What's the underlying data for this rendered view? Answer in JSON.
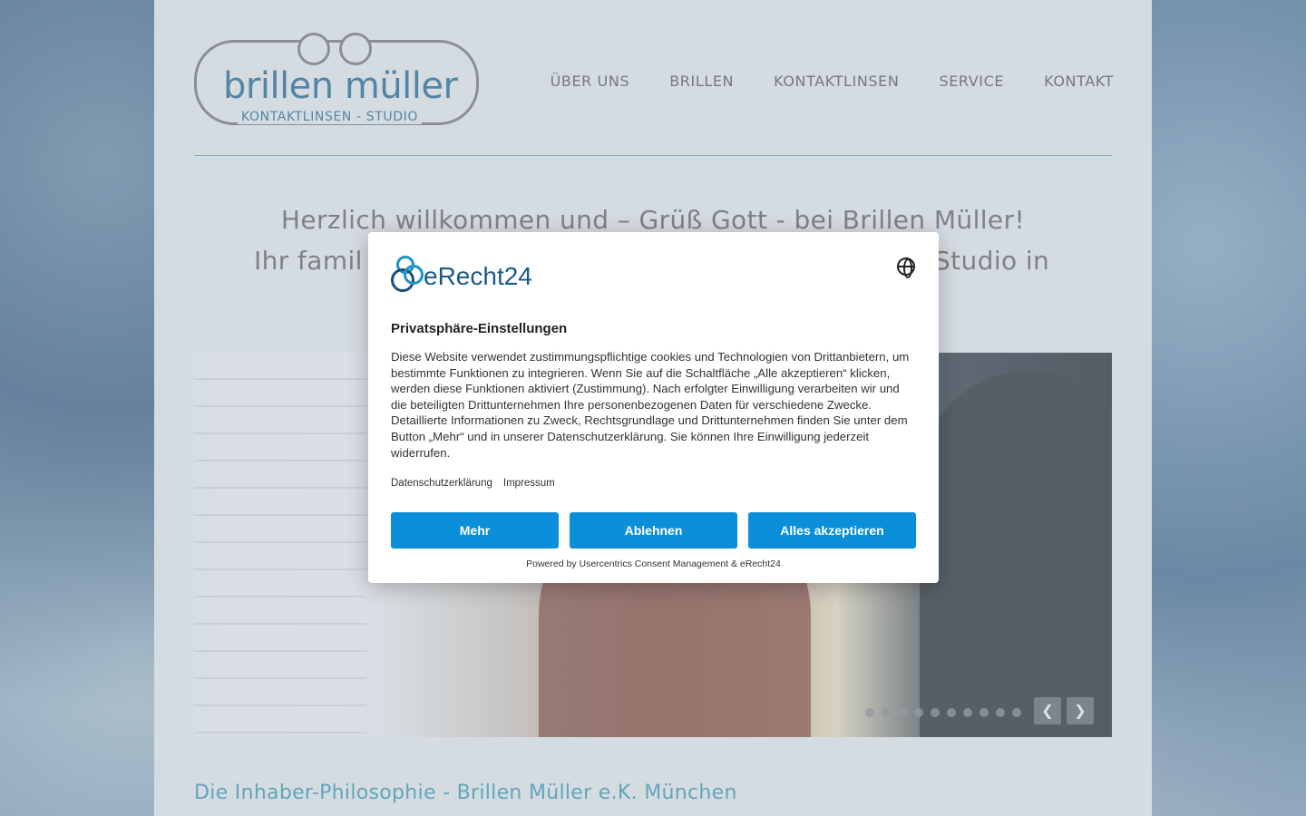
{
  "logo": {
    "name": "brillen müller",
    "subtitle": "KONTAKTLINSEN - STUDIO"
  },
  "nav": {
    "items": [
      "ÜBER UNS",
      "BRILLEN",
      "KONTAKTLINSEN",
      "SERVICE",
      "KONTAKT"
    ]
  },
  "welcome": {
    "line1": "Herzlich willkommen und – Grüß Gott - bei Brillen Müller!",
    "line2_left": "Ihr famil",
    "line2_right": "Studio in"
  },
  "slider": {
    "dot_count": 10,
    "prev_icon": "chevron-left-icon",
    "next_icon": "chevron-right-icon"
  },
  "section": {
    "heading": "Die Inhaber-Philosophie - Brillen Müller e.K. München"
  },
  "consent": {
    "brand": "eRecht24",
    "language_icon": "globe-icon",
    "title": "Privatsphäre-Einstellungen",
    "body": "Diese Website verwendet zustimmungspflichtige cookies und Technologien von Drittanbietern, um bestimmte Funktionen zu integrieren. Wenn Sie auf die Schaltfläche „Alle akzeptieren“ klicken, werden diese Funktionen aktiviert (Zustimmung). Nach erfolgter Einwilligung verarbeiten wir und die beteiligten Drittunternehmen Ihre personenbezogenen Daten für verschiedene Zwecke. Detaillierte Informationen zu Zweck, Rechtsgrundlage und Drittunternehmen finden Sie unter dem Button „Mehr“ und in unserer Datenschutzerklärung. Sie können Ihre Einwilligung jederzeit widerrufen.",
    "links": {
      "privacy": "Datenschutzerklärung",
      "imprint": "Impressum"
    },
    "buttons": {
      "more": "Mehr",
      "decline": "Ablehnen",
      "accept_all": "Alles akzeptieren"
    },
    "powered_by": "Powered by Usercentrics Consent Management & eRecht24",
    "button_color": "#0a8fd8"
  }
}
